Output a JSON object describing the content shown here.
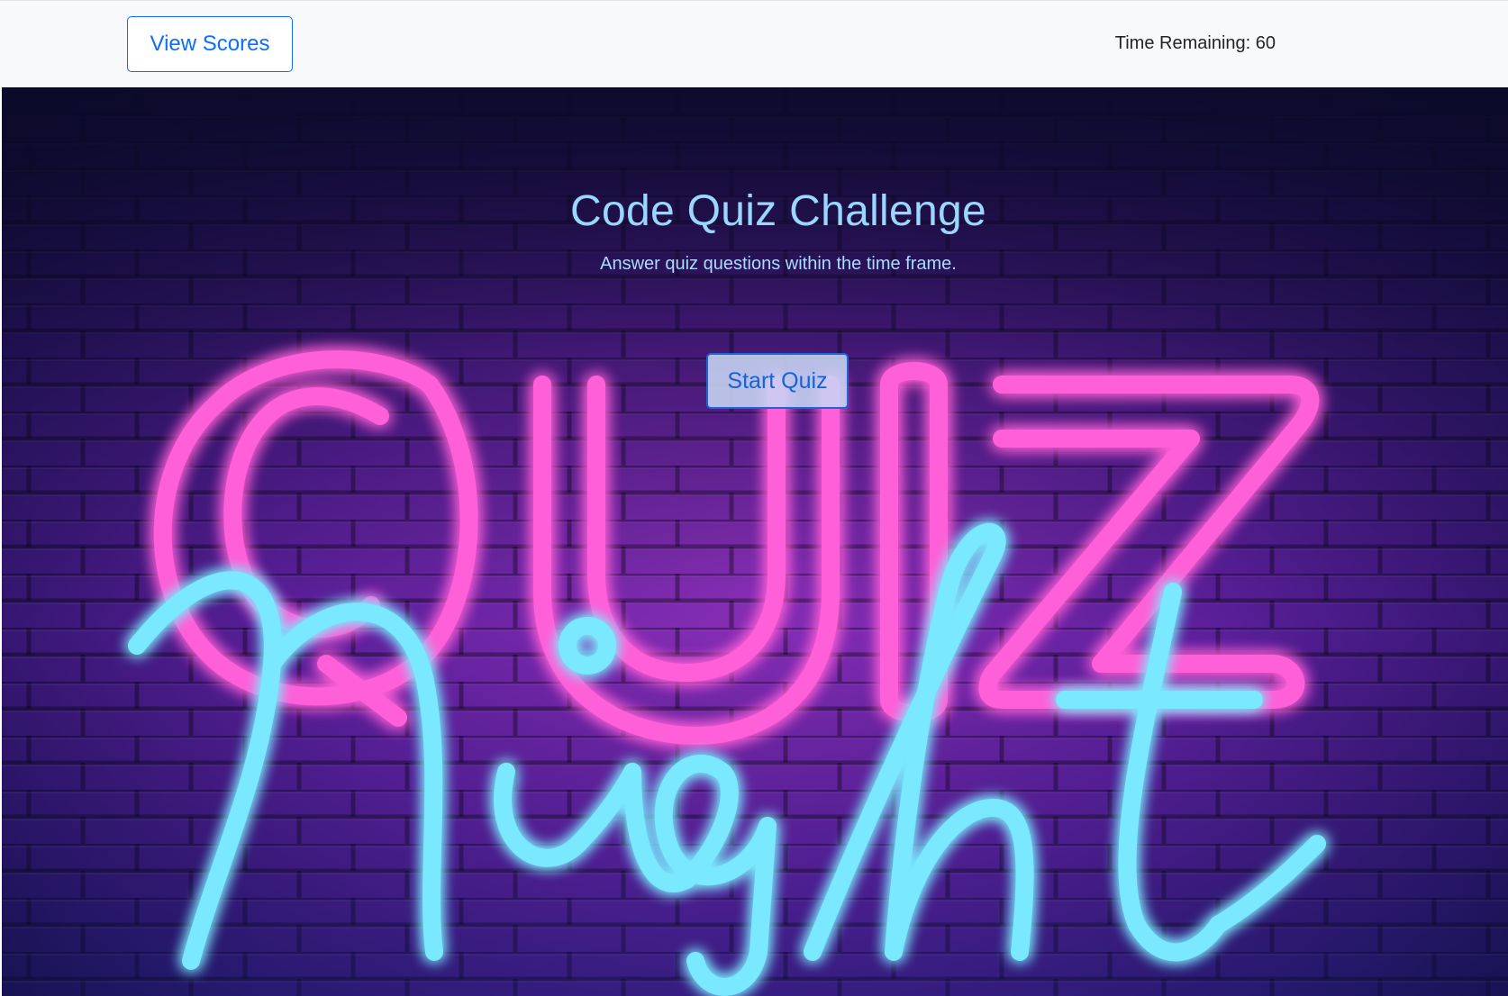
{
  "header": {
    "view_scores_label": "View Scores",
    "time_label": "Time Remaining: ",
    "time_value": "60"
  },
  "hero": {
    "title": "Code Quiz Challenge",
    "subtitle": "Answer quiz questions within the time frame.",
    "start_button_label": "Start Quiz",
    "background_sign_text": "Quiz Night"
  },
  "colors": {
    "primary": "#0d6efd",
    "neon_pink": "#ff4fd6",
    "neon_cyan": "#6fe6ff",
    "wall_dark": "#140c3a",
    "wall_mid": "#6a1fa8",
    "topbar_bg": "#f8f9fa"
  }
}
